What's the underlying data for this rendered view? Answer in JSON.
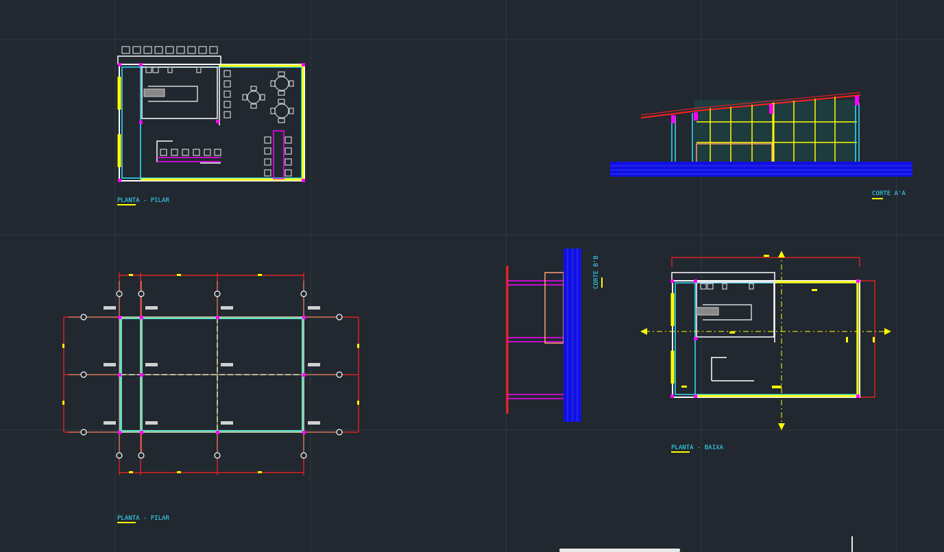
{
  "labels": {
    "planta_pilar_top": "PLANTA  -  PILAR",
    "corte_aa": "CORTE  A'A",
    "corte_bb": "CORTE  B'B",
    "planta_pilar_bottom": "PLANTA  -  PILAR",
    "planta_baixa": "PLANTA  -  BAIXA"
  },
  "colors": {
    "background": "#212830",
    "grid": "#2f3842",
    "cyan": "#38e1ff",
    "yellow": "#ffff00",
    "red": "#ff2020",
    "magenta": "#ff00ff",
    "white": "#ffffff",
    "blue": "#1010e0",
    "salmon": "#ff9f70",
    "teal": "#5fe0c8"
  }
}
